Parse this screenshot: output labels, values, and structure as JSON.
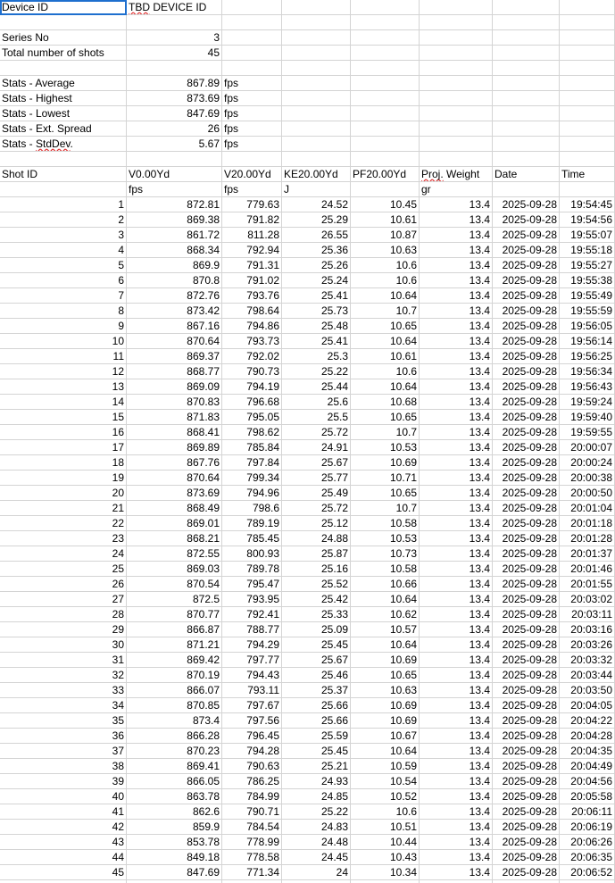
{
  "device": {
    "label": "Device ID",
    "value": "TBD DEVICE ID",
    "value_flagged_word": "TBD"
  },
  "series": {
    "label": "Series No",
    "value": "3"
  },
  "total_shots": {
    "label": "Total number of shots",
    "value": "45"
  },
  "stats": [
    {
      "label": "Stats - Average",
      "value": "867.89",
      "unit": "fps"
    },
    {
      "label": "Stats - Highest",
      "value": "873.69",
      "unit": "fps"
    },
    {
      "label": "Stats - Lowest",
      "value": "847.69",
      "unit": "fps"
    },
    {
      "label": "Stats - Ext. Spread",
      "value": "26",
      "unit": "fps"
    },
    {
      "label": "Stats - StdDev.",
      "value": "5.67",
      "unit": "fps"
    }
  ],
  "table": {
    "headers": [
      "Shot ID",
      "V0.00Yd",
      "V20.00Yd",
      "KE20.00Yd",
      "PF20.00Yd",
      "Proj. Weight",
      "Date",
      "Time"
    ],
    "units": [
      "",
      "fps",
      "fps",
      "J",
      "",
      "gr",
      "",
      ""
    ],
    "rows": [
      [
        "1",
        "872.81",
        "779.63",
        "24.52",
        "10.45",
        "13.4",
        "2025-09-28",
        "19:54:45"
      ],
      [
        "2",
        "869.38",
        "791.82",
        "25.29",
        "10.61",
        "13.4",
        "2025-09-28",
        "19:54:56"
      ],
      [
        "3",
        "861.72",
        "811.28",
        "26.55",
        "10.87",
        "13.4",
        "2025-09-28",
        "19:55:07"
      ],
      [
        "4",
        "868.34",
        "792.94",
        "25.36",
        "10.63",
        "13.4",
        "2025-09-28",
        "19:55:18"
      ],
      [
        "5",
        "869.9",
        "791.31",
        "25.26",
        "10.6",
        "13.4",
        "2025-09-28",
        "19:55:27"
      ],
      [
        "6",
        "870.8",
        "791.02",
        "25.24",
        "10.6",
        "13.4",
        "2025-09-28",
        "19:55:38"
      ],
      [
        "7",
        "872.76",
        "793.76",
        "25.41",
        "10.64",
        "13.4",
        "2025-09-28",
        "19:55:49"
      ],
      [
        "8",
        "873.42",
        "798.64",
        "25.73",
        "10.7",
        "13.4",
        "2025-09-28",
        "19:55:59"
      ],
      [
        "9",
        "867.16",
        "794.86",
        "25.48",
        "10.65",
        "13.4",
        "2025-09-28",
        "19:56:05"
      ],
      [
        "10",
        "870.64",
        "793.73",
        "25.41",
        "10.64",
        "13.4",
        "2025-09-28",
        "19:56:14"
      ],
      [
        "11",
        "869.37",
        "792.02",
        "25.3",
        "10.61",
        "13.4",
        "2025-09-28",
        "19:56:25"
      ],
      [
        "12",
        "868.77",
        "790.73",
        "25.22",
        "10.6",
        "13.4",
        "2025-09-28",
        "19:56:34"
      ],
      [
        "13",
        "869.09",
        "794.19",
        "25.44",
        "10.64",
        "13.4",
        "2025-09-28",
        "19:56:43"
      ],
      [
        "14",
        "870.83",
        "796.68",
        "25.6",
        "10.68",
        "13.4",
        "2025-09-28",
        "19:59:24"
      ],
      [
        "15",
        "871.83",
        "795.05",
        "25.5",
        "10.65",
        "13.4",
        "2025-09-28",
        "19:59:40"
      ],
      [
        "16",
        "868.41",
        "798.62",
        "25.72",
        "10.7",
        "13.4",
        "2025-09-28",
        "19:59:55"
      ],
      [
        "17",
        "869.89",
        "785.84",
        "24.91",
        "10.53",
        "13.4",
        "2025-09-28",
        "20:00:07"
      ],
      [
        "18",
        "867.76",
        "797.84",
        "25.67",
        "10.69",
        "13.4",
        "2025-09-28",
        "20:00:24"
      ],
      [
        "19",
        "870.64",
        "799.34",
        "25.77",
        "10.71",
        "13.4",
        "2025-09-28",
        "20:00:38"
      ],
      [
        "20",
        "873.69",
        "794.96",
        "25.49",
        "10.65",
        "13.4",
        "2025-09-28",
        "20:00:50"
      ],
      [
        "21",
        "868.49",
        "798.6",
        "25.72",
        "10.7",
        "13.4",
        "2025-09-28",
        "20:01:04"
      ],
      [
        "22",
        "869.01",
        "789.19",
        "25.12",
        "10.58",
        "13.4",
        "2025-09-28",
        "20:01:18"
      ],
      [
        "23",
        "868.21",
        "785.45",
        "24.88",
        "10.53",
        "13.4",
        "2025-09-28",
        "20:01:28"
      ],
      [
        "24",
        "872.55",
        "800.93",
        "25.87",
        "10.73",
        "13.4",
        "2025-09-28",
        "20:01:37"
      ],
      [
        "25",
        "869.03",
        "789.78",
        "25.16",
        "10.58",
        "13.4",
        "2025-09-28",
        "20:01:46"
      ],
      [
        "26",
        "870.54",
        "795.47",
        "25.52",
        "10.66",
        "13.4",
        "2025-09-28",
        "20:01:55"
      ],
      [
        "27",
        "872.5",
        "793.95",
        "25.42",
        "10.64",
        "13.4",
        "2025-09-28",
        "20:03:02"
      ],
      [
        "28",
        "870.77",
        "792.41",
        "25.33",
        "10.62",
        "13.4",
        "2025-09-28",
        "20:03:11"
      ],
      [
        "29",
        "866.87",
        "788.77",
        "25.09",
        "10.57",
        "13.4",
        "2025-09-28",
        "20:03:16"
      ],
      [
        "30",
        "871.21",
        "794.29",
        "25.45",
        "10.64",
        "13.4",
        "2025-09-28",
        "20:03:26"
      ],
      [
        "31",
        "869.42",
        "797.77",
        "25.67",
        "10.69",
        "13.4",
        "2025-09-28",
        "20:03:32"
      ],
      [
        "32",
        "870.19",
        "794.43",
        "25.46",
        "10.65",
        "13.4",
        "2025-09-28",
        "20:03:44"
      ],
      [
        "33",
        "866.07",
        "793.11",
        "25.37",
        "10.63",
        "13.4",
        "2025-09-28",
        "20:03:50"
      ],
      [
        "34",
        "870.85",
        "797.67",
        "25.66",
        "10.69",
        "13.4",
        "2025-09-28",
        "20:04:05"
      ],
      [
        "35",
        "873.4",
        "797.56",
        "25.66",
        "10.69",
        "13.4",
        "2025-09-28",
        "20:04:22"
      ],
      [
        "36",
        "866.28",
        "796.45",
        "25.59",
        "10.67",
        "13.4",
        "2025-09-28",
        "20:04:28"
      ],
      [
        "37",
        "870.23",
        "794.28",
        "25.45",
        "10.64",
        "13.4",
        "2025-09-28",
        "20:04:35"
      ],
      [
        "38",
        "869.41",
        "790.63",
        "25.21",
        "10.59",
        "13.4",
        "2025-09-28",
        "20:04:49"
      ],
      [
        "39",
        "866.05",
        "786.25",
        "24.93",
        "10.54",
        "13.4",
        "2025-09-28",
        "20:04:56"
      ],
      [
        "40",
        "863.78",
        "784.99",
        "24.85",
        "10.52",
        "13.4",
        "2025-09-28",
        "20:05:58"
      ],
      [
        "41",
        "862.6",
        "790.71",
        "25.22",
        "10.6",
        "13.4",
        "2025-09-28",
        "20:06:11"
      ],
      [
        "42",
        "859.9",
        "784.54",
        "24.83",
        "10.51",
        "13.4",
        "2025-09-28",
        "20:06:19"
      ],
      [
        "43",
        "853.78",
        "778.99",
        "24.48",
        "10.44",
        "13.4",
        "2025-09-28",
        "20:06:26"
      ],
      [
        "44",
        "849.18",
        "778.58",
        "24.45",
        "10.43",
        "13.4",
        "2025-09-28",
        "20:06:35"
      ],
      [
        "45",
        "847.69",
        "771.34",
        "24",
        "10.34",
        "13.4",
        "2025-09-28",
        "20:06:52"
      ]
    ]
  }
}
